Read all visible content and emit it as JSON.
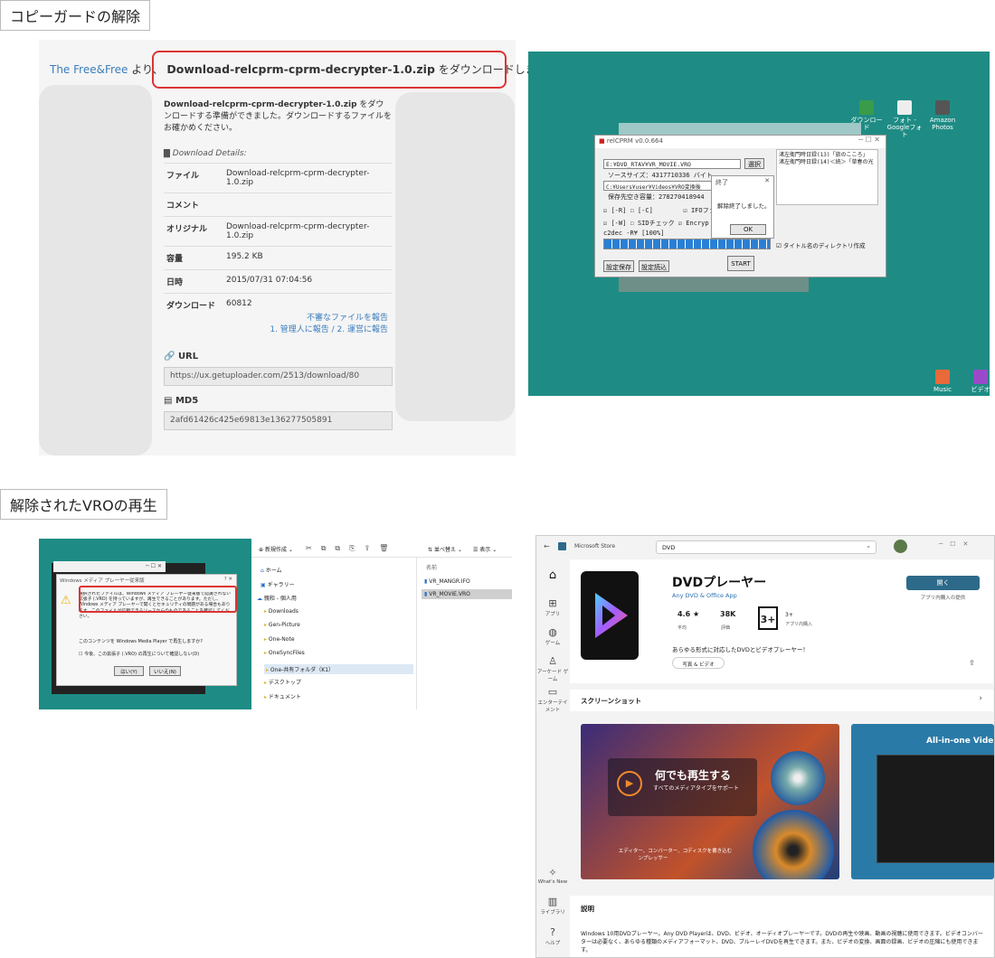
{
  "sections": {
    "copyguard_title": "コピーガードの解除",
    "playback_title": "解除されたVROの再生"
  },
  "download_page": {
    "site_link": "The Free&Free",
    "yori": "より、",
    "file_bold": "Download-relcprm-cprm-decrypter-1.0.zip",
    "head_suffix": "をダウンロードします。",
    "prep_file": "Download-relcprm-cprm-decrypter-1.0.zip",
    "prep_text": "をダウンロードする準備ができました。ダウンロードするファイルをお確かめください。",
    "details_label": "Download Details:",
    "rows": [
      {
        "key": "ファイル",
        "value": "Download-relcprm-cprm-decrypter-1.0.zip"
      },
      {
        "key": "コメント",
        "value": ""
      },
      {
        "key": "オリジナル",
        "value": "Download-relcprm-cprm-decrypter-1.0.zip"
      },
      {
        "key": "容量",
        "value": "195.2 KB"
      },
      {
        "key": "日時",
        "value": "2015/07/31 07:04:56"
      },
      {
        "key": "ダウンロード",
        "value": "60812"
      }
    ],
    "report_1": "不審なファイルを報告",
    "report_2": "1. 管理人に報告 / 2. 運営に報告",
    "url_label": "URL",
    "url_value": "https://ux.getuploader.com/2513/download/80",
    "md5_label": "MD5",
    "md5_value": "2afd61426c425e69813e136277505891"
  },
  "relcprm": {
    "desktop_icons": [
      {
        "label": "ダウンロード",
        "icon": "folder-icon"
      },
      {
        "label": "フォト - Googleフォト",
        "icon": "photo-icon"
      },
      {
        "label": "Amazon Photos",
        "icon": "photo-icon"
      },
      {
        "label": "Music",
        "icon": "music-icon"
      },
      {
        "label": "ビデオ",
        "icon": "video-icon"
      }
    ],
    "title": "relCPRM v0.0.664",
    "source_path": "E:¥DVD_RTAV¥VR_MOVIE.VRO",
    "select_btn": "選択",
    "source_size": "ソースサイズ：4317710336 バイト",
    "out_path": "C:¥Users¥user¥Videos¥VRO変換後",
    "free_space": "保存先空き容量：278270418944",
    "log_1": "渚左衛門時日録(13)「旅のこころ」",
    "log_2": "渚左衛門時日録(14)＜続＞「草春の光",
    "opt_r": "[-R]",
    "opt_c": "[-C]",
    "opt_ifo": "IFOファ",
    "opt_w": "[-W]",
    "opt_sid": "SIDチェック",
    "opt_enc": "Encryp",
    "c2dec": "c2dec -R¥ [100%]",
    "title_dir": "タイトル名のディレクトリ作成",
    "save_btn": "設定保存",
    "load_btn": "設定読込",
    "start_btn": "START",
    "dialog_title": "終了",
    "dialog_msg": "解除終了しました。",
    "ok": "OK"
  },
  "explorer": {
    "wmp_title": "Windows メディア プレーヤー従来版",
    "wmp_msg": "選択されたファイルは、Windows メディア プレーヤー従来版で認識されない拡張子 (.VRO) を持っていますが、再生できることがあります。ただし、Windows メディア プレーヤーで開くとセキュリティの問題がある場合もあります。このファイルが信頼できるソースからのものであることを確認してください。",
    "wmp_q": "このコンテンツを Windows Media Player で再生しますか?",
    "wmp_check": "今後、この拡張子 (.VRO) の再生について確認しない(D)",
    "yes": "はい(Y)",
    "no": "いいえ(N)",
    "toolbar_new": "新規作成",
    "toolbar_sort": "並べ替え",
    "toolbar_view": "表示",
    "nav": [
      "ホーム",
      "ギャラリー",
      "親和 - 個人用",
      "Downloads",
      "Gen-Picture",
      "One-Note",
      "OneSyncFiles",
      "One-共有フォルダ（K1）",
      "デスクトップ",
      "ドキュメント"
    ],
    "col_name": "名前",
    "files": [
      "VR_MANGR.IFO",
      "VR_MOVIE.VRO"
    ]
  },
  "store": {
    "app_name": "Microsoft Store",
    "search": "DVD",
    "title": "DVDプレーヤー",
    "publisher": "Any DVD & Office App",
    "rating": "4.6",
    "rating_label": "平均",
    "reviews": "38K",
    "reviews_label": "評価",
    "iarc": "3+",
    "iarc_label": "アプリ内購入",
    "open_btn": "開く",
    "iap": "アプリ内購入の提供",
    "desc_short": "あらゆる形式に対応したDVDとビデオプレーヤー！",
    "tag": "写真 & ビデオ",
    "screenshots": "スクリーンショット",
    "promo_1": "何でも再生する",
    "promo_2": "すべてのメディアタイプをサポート",
    "promo_3": "エディター、コンバーター、コンプレッサー",
    "promo_4": "ディスクを書き込む",
    "promo_5": "All-in-one Vide",
    "desc_title": "説明",
    "desc": "Windows 10用DVDプレーヤー。Any DVD Playerは、DVD、ビデオ、オーディオプレーヤーです。DVDの再生や映画、動画の視聴に使用できます。ビデオコンバーターは必要なく、あらゆる種類のメディアフォーマット、DVD、ブルーレイDVDを再生できます。また、ビデオの変換、画面の録画、ビデオの圧縮にも使用できます。",
    "side": [
      {
        "label": "",
        "icon": "home-icon"
      },
      {
        "label": "アプリ",
        "icon": "apps-icon"
      },
      {
        "label": "ゲーム",
        "icon": "game-icon"
      },
      {
        "label": "アーケード ゲーム",
        "icon": "arcade-icon"
      },
      {
        "label": "エンターテイメント",
        "icon": "entertainment-icon"
      },
      {
        "label": "What's New",
        "icon": "new-icon"
      },
      {
        "label": "ライブラリ",
        "icon": "library-icon"
      },
      {
        "label": "ヘルプ",
        "icon": "help-icon"
      }
    ]
  },
  "colors": {
    "teal": "#1e8c84",
    "red": "#d33333",
    "link": "#3a7dbd",
    "store_btn": "#2d6a8a"
  }
}
